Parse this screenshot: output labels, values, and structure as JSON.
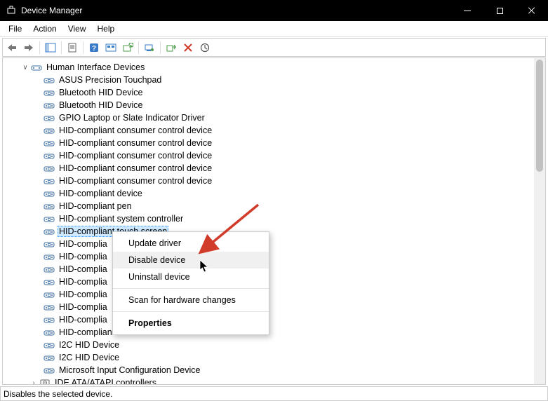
{
  "window": {
    "title": "Device Manager",
    "minimize_tooltip": "Minimize",
    "maximize_tooltip": "Maximize",
    "close_tooltip": "Close"
  },
  "menubar": [
    "File",
    "Action",
    "View",
    "Help"
  ],
  "toolbar": [
    {
      "name": "back-icon"
    },
    {
      "name": "forward-icon"
    },
    {
      "sep": true
    },
    {
      "name": "show-hide-tree-icon"
    },
    {
      "sep": true
    },
    {
      "name": "properties-icon"
    },
    {
      "sep": true
    },
    {
      "name": "help-icon"
    },
    {
      "name": "refresh-icon"
    },
    {
      "name": "print-icon"
    },
    {
      "sep": true
    },
    {
      "name": "monitor-icon"
    },
    {
      "sep": true
    },
    {
      "name": "enable-icon"
    },
    {
      "name": "disable-x-icon"
    },
    {
      "name": "update-driver-icon"
    }
  ],
  "tree": {
    "category": "Human Interface Devices",
    "devices": [
      "ASUS Precision Touchpad",
      "Bluetooth HID Device",
      "Bluetooth HID Device",
      "GPIO Laptop or Slate Indicator Driver",
      "HID-compliant consumer control device",
      "HID-compliant consumer control device",
      "HID-compliant consumer control device",
      "HID-compliant consumer control device",
      "HID-compliant consumer control device",
      "HID-compliant device",
      "HID-compliant pen",
      "HID-compliant system controller",
      "HID-compliant touch screen",
      "HID-complia",
      "HID-complia",
      "HID-complia",
      "HID-complia",
      "HID-complia",
      "HID-complia",
      "HID-complia",
      "HID-compliant vendor-defined device",
      "I2C HID Device",
      "I2C HID Device",
      "Microsoft Input Configuration Device"
    ],
    "next_category": "IDE ATA/ATAPI controllers",
    "selected_index": 12
  },
  "context_menu": {
    "items": [
      {
        "label": "Update driver"
      },
      {
        "label": "Disable device",
        "hover": true
      },
      {
        "label": "Uninstall device"
      },
      {
        "sep": true
      },
      {
        "label": "Scan for hardware changes"
      },
      {
        "sep": true
      },
      {
        "label": "Properties",
        "bold": true
      }
    ]
  },
  "statusbar": "Disables the selected device."
}
